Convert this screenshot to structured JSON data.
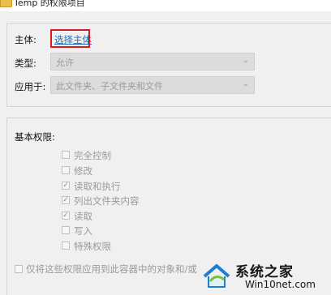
{
  "window": {
    "title": "Temp 的权限项目"
  },
  "principal": {
    "label": "主体:",
    "link": "选择主体"
  },
  "type": {
    "label": "类型:",
    "value": "允许"
  },
  "applies_to": {
    "label": "应用于:",
    "value": "此文件夹、子文件夹和文件"
  },
  "permissions": {
    "heading": "基本权限:",
    "items": [
      {
        "label": "完全控制",
        "checked": false
      },
      {
        "label": "修改",
        "checked": false
      },
      {
        "label": "读取和执行",
        "checked": true
      },
      {
        "label": "列出文件夹内容",
        "checked": true
      },
      {
        "label": "读取",
        "checked": true
      },
      {
        "label": "写入",
        "checked": false
      },
      {
        "label": "特殊权限",
        "checked": false
      }
    ]
  },
  "apply_option": {
    "label": "仅将这些权限应用到此容器中的对象和/或",
    "checked": false
  },
  "watermark": {
    "title": "系统之家",
    "subtitle": "Win10net.com"
  },
  "colors": {
    "link": "#1a6fc4",
    "highlight": "#d41c24",
    "disabled_text": "#9a9a9a"
  }
}
